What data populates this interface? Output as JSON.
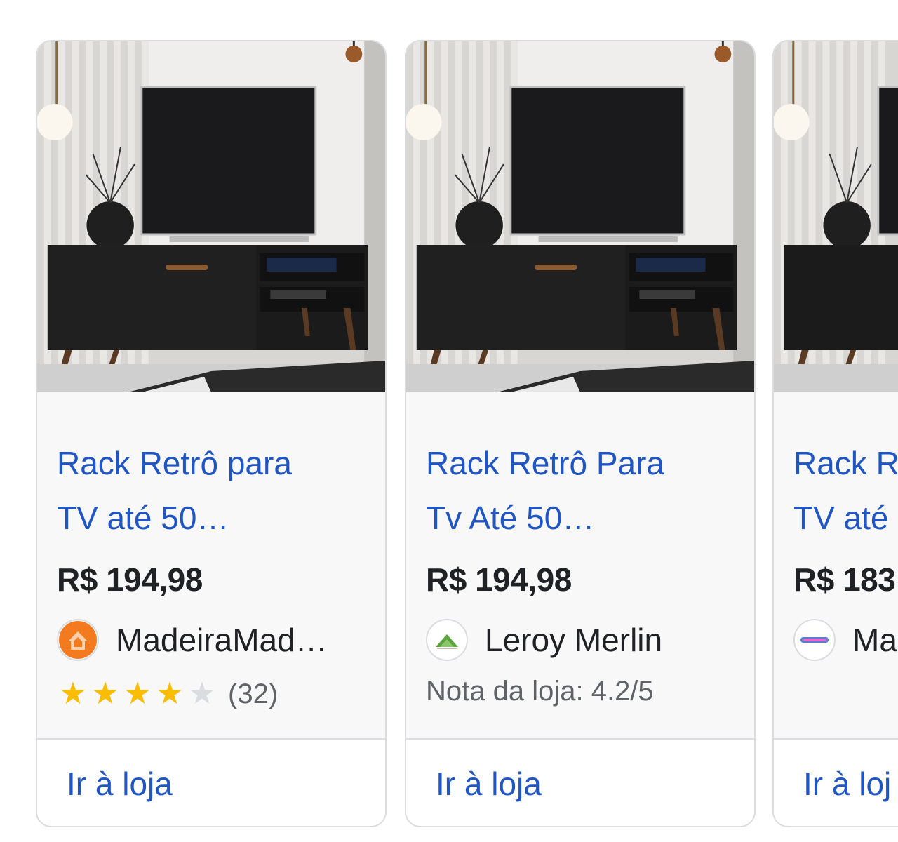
{
  "products": [
    {
      "title_line1": "Rack Retrô para",
      "title_line2": "TV até 50…",
      "price": "R$ 194,98",
      "seller": "MadeiraMad…",
      "seller_logo": "madeiramadeira-house-icon",
      "rating_stars": 4,
      "rating_count": "(32)",
      "cta": "Ir à loja"
    },
    {
      "title_line1": "Rack Retrô Para",
      "title_line2": "Tv Até 50…",
      "price": "R$ 194,98",
      "seller": "Leroy Merlin",
      "seller_logo": "leroy-merlin-logo-icon",
      "store_note": "Nota da loja: 4.2/5",
      "cta": "Ir à loja"
    },
    {
      "title_line1": "Rack R",
      "title_line2": "TV até",
      "price": "R$ 183",
      "seller": "Ma",
      "seller_logo": "mobly-logo-icon",
      "cta": "Ir à loj"
    }
  ],
  "colors": {
    "link": "#1f55c4",
    "star": "#fbbc04",
    "border": "#dadce0"
  }
}
